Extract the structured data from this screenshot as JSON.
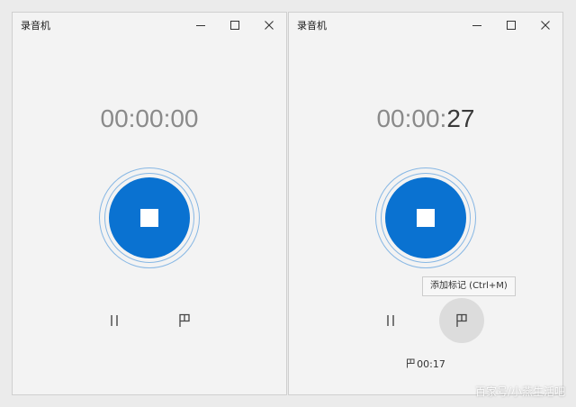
{
  "left_window": {
    "title": "录音机",
    "timer": "00:00:00"
  },
  "right_window": {
    "title": "录音机",
    "timer_prefix": "00:00:",
    "timer_seconds": "27",
    "tooltip": "添加标记 (Ctrl+M)",
    "marker_time": "00:17"
  },
  "icons": {
    "minimize": "minimize-icon",
    "maximize": "maximize-icon",
    "close": "close-icon",
    "stop": "stop-icon",
    "pause": "pause-icon",
    "flag": "flag-icon"
  },
  "colors": {
    "accent": "#0a72d1",
    "ring": "#87b7e4",
    "window_bg": "#f3f3f3"
  },
  "watermark": "百家号/小燕生活吧"
}
